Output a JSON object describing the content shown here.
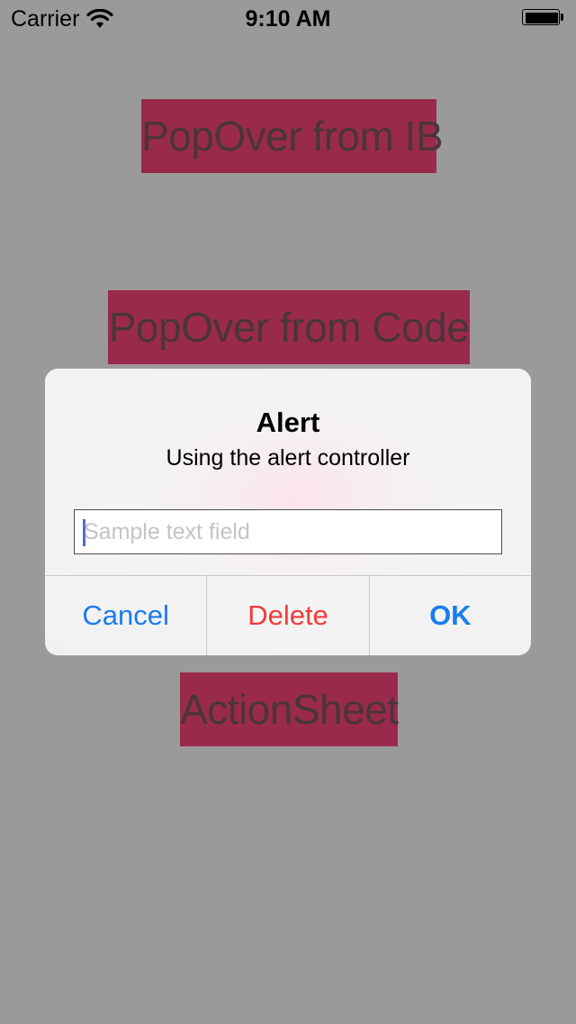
{
  "status_bar": {
    "carrier": "Carrier",
    "time": "9:10 AM",
    "wifi_icon": "wifi-icon",
    "battery_icon": "battery-full-icon"
  },
  "buttons": {
    "popover_ib": "PopOver from IB",
    "popover_code": "PopOver from Code",
    "action_sheet": "ActionSheet"
  },
  "alert": {
    "title": "Alert",
    "message": "Using the alert controller",
    "text_field": {
      "value": "",
      "placeholder": "Sample text field"
    },
    "actions": {
      "cancel": "Cancel",
      "delete": "Delete",
      "ok": "OK"
    }
  },
  "colors": {
    "background": "#9a9a9a",
    "button_fill": "#9a2a4c",
    "button_text": "#4a3538",
    "action_blue": "#1a7cf0",
    "action_destructive": "#f23a3a"
  }
}
